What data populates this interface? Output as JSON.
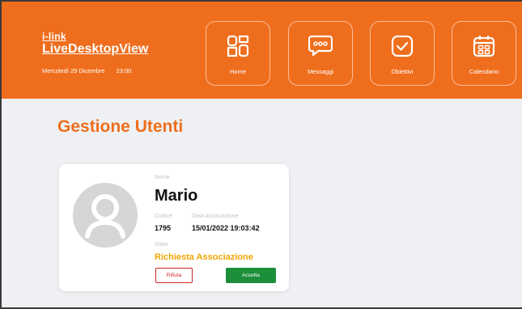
{
  "header": {
    "brand_small": "i-link",
    "brand_main": "LiveDesktopView",
    "date": "Mercoledì 29 Dicembre",
    "time": "23:00",
    "nav": [
      {
        "label": "Home",
        "icon": "home-grid-icon"
      },
      {
        "label": "Messaggi",
        "icon": "chat-bubble-icon"
      },
      {
        "label": "Obiettivi",
        "icon": "checkbox-icon"
      },
      {
        "label": "Calendario",
        "icon": "calendar-icon"
      }
    ]
  },
  "main": {
    "title": "Gestione Utenti",
    "card": {
      "name_label": "Nome",
      "name": "Mario",
      "code_label": "Codice",
      "code": "1795",
      "assoc_label": "Data Associazione",
      "assoc_date": "15/01/2022 19:03:42",
      "status_label": "Stato",
      "status": "Richiesta Associazione",
      "reject_label": "Rifiuta",
      "accept_label": "Accetta"
    }
  },
  "colors": {
    "brand_orange": "#ef6e1d",
    "status_amber": "#f0a500",
    "reject_red": "#d32626",
    "accept_green": "#1d8f3a"
  }
}
